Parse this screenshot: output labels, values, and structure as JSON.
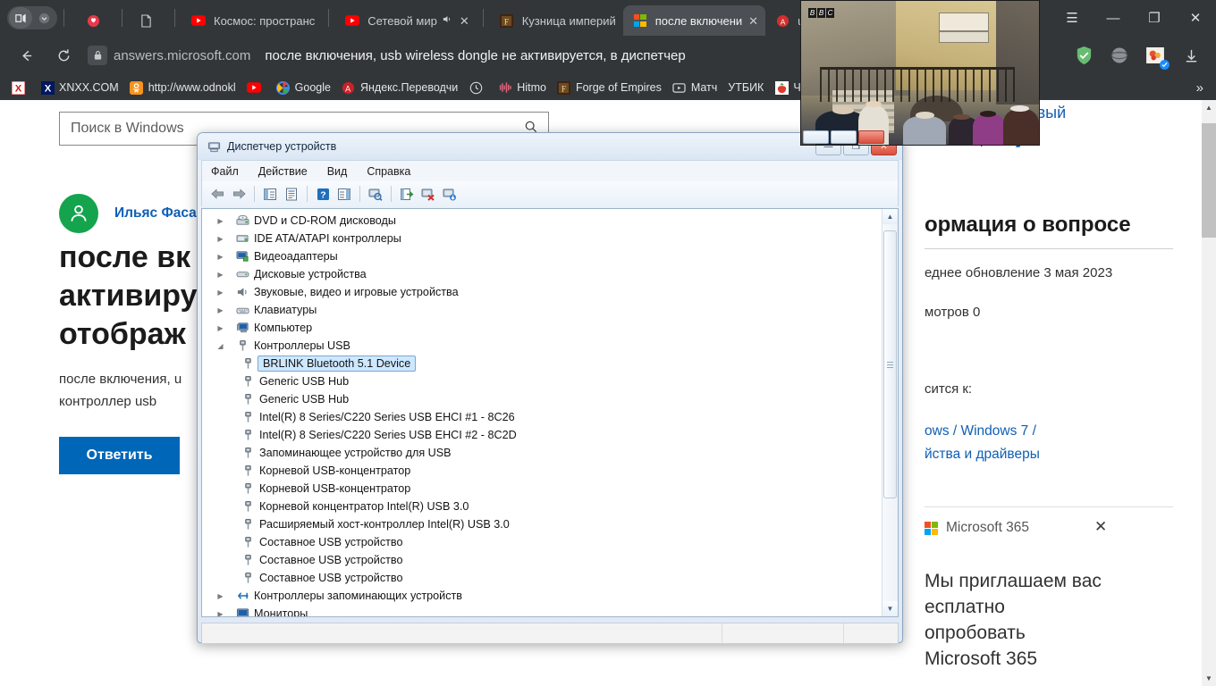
{
  "browser": {
    "tab_search_icon": "tab-list-icon",
    "tab_search_chevron": "chevron-down-icon",
    "tabs": [
      {
        "icon": "opera-heart-icon",
        "title": "",
        "has_close": false,
        "active": false
      },
      {
        "icon": "page-icon",
        "title": "",
        "has_close": false,
        "active": false
      },
      {
        "icon": "youtube-icon",
        "title": "Космос: пространс",
        "has_close": false,
        "active": false
      },
      {
        "icon": "youtube-icon",
        "title": "Сетевой мир",
        "has_close": true,
        "muted": true,
        "active": false
      },
      {
        "icon": "forge-icon",
        "title": "Кузница империй",
        "has_close": false,
        "active": false
      },
      {
        "icon": "microsoft-icon",
        "title": "после включени",
        "has_close": true,
        "active": true
      },
      {
        "icon": "avito-icon",
        "title": "us",
        "has_close": false,
        "active": false
      }
    ],
    "window_controls": {
      "menu": "☰",
      "minimize": "—",
      "maximize": "❐",
      "close": "✕"
    },
    "toolbar": {
      "back_icon": "arrow-left-icon",
      "reload_icon": "reload-icon",
      "lock_icon": "lock-icon",
      "url_host": "answers.microsoft.com",
      "url_title": "после включения, usb wireless dongle не активируется, в диспетчер",
      "extensions": [
        "adguard-shield-icon",
        "opera-vpn-icon",
        "flower-extension-icon"
      ],
      "download_icon": "download-icon"
    },
    "bookmarks": [
      {
        "icon": "x-red-icon",
        "label": ""
      },
      {
        "icon": "xnxx-icon",
        "label": "XNXX.COM"
      },
      {
        "icon": "odnoklassniki-icon",
        "label": "http://www.odnokl"
      },
      {
        "icon": "youtube-icon",
        "label": ""
      },
      {
        "icon": "google-icon",
        "label": "Google"
      },
      {
        "icon": "yandex-translate-icon",
        "label": "Яндекс.Переводчи"
      },
      {
        "icon": "clock-icon",
        "label": ""
      },
      {
        "icon": "hitmo-icon",
        "label": "Hitmo"
      },
      {
        "icon": "forge-icon",
        "label": "Forge of Empires"
      },
      {
        "icon": "match-tv-icon",
        "label": "Матч"
      },
      {
        "icon": "futbik-icon",
        "label": "УТБИК"
      },
      {
        "icon": "strawberry-icon",
        "label": "Чудо"
      },
      {
        "icon": "devil-icon",
        "label": ""
      }
    ],
    "bookmarks_overflow": "»"
  },
  "page": {
    "search_placeholder": "Поиск в Windows",
    "search_icon": "search-icon",
    "author": "Ильяс Фасах",
    "avatar_icon": "user-avatar-icon",
    "question_title_lines": [
      "после вк",
      "активиру",
      "отображ"
    ],
    "question_body_lines": [
      "после включения, u",
      "контроллер usb"
    ],
    "answer_button": "Ответить",
    "right": {
      "ask_link_line1": "дайте новый",
      "ask_link_line2": "прос",
      "ask_chevron": "❯",
      "info_heading": "ормация о вопросе",
      "last_updated": "еднее обновление 3 мая 2023",
      "views": "мотров 0",
      "applies_to": "сится к:",
      "links_line1": "ows / Windows 7 /",
      "links_line2": "йства и драйверы",
      "promo_brand": "Microsoft 365",
      "promo_close": "✕",
      "promo_lines": [
        "Мы приглашаем вас",
        "есплатно",
        "опробовать",
        "Microsoft 365"
      ]
    },
    "scrollbar": {
      "up": "▲",
      "down": "▼"
    }
  },
  "device_manager": {
    "title": "Диспетчер устройств",
    "title_icon": "device-manager-icon",
    "window_buttons": {
      "minimize": "—",
      "maximize": "❐",
      "close": "✕"
    },
    "menus": [
      "Файл",
      "Действие",
      "Вид",
      "Справка"
    ],
    "toolbar_icons": [
      "back-arrow-icon",
      "forward-arrow-icon",
      "sep",
      "show-hidden-icon",
      "properties-icon",
      "sep",
      "help-icon",
      "view-devices-icon",
      "sep",
      "scan-hardware-icon",
      "sep",
      "update-driver-icon",
      "uninstall-device-icon",
      "enable-device-icon"
    ],
    "tree": [
      {
        "label": "DVD и CD-ROM дисководы",
        "icon": "dvd-drive-icon",
        "level": 0,
        "expander": "▶",
        "selected": false
      },
      {
        "label": "IDE ATA/ATAPI контроллеры",
        "icon": "ide-controller-icon",
        "level": 0,
        "expander": "▶",
        "selected": false
      },
      {
        "label": "Видеоадаптеры",
        "icon": "display-adapter-icon",
        "level": 0,
        "expander": "▶",
        "selected": false
      },
      {
        "label": "Дисковые устройства",
        "icon": "disk-drive-icon",
        "level": 0,
        "expander": "▶",
        "selected": false
      },
      {
        "label": "Звуковые, видео и игровые устройства",
        "icon": "sound-device-icon",
        "level": 0,
        "expander": "▶",
        "selected": false
      },
      {
        "label": "Клавиатуры",
        "icon": "keyboard-icon",
        "level": 0,
        "expander": "▶",
        "selected": false
      },
      {
        "label": "Компьютер",
        "icon": "computer-icon",
        "level": 0,
        "expander": "▶",
        "selected": false
      },
      {
        "label": "Контроллеры USB",
        "icon": "usb-icon",
        "level": 0,
        "expander": "◢",
        "selected": false
      },
      {
        "label": "BRLINK Bluetooth 5.1 Device",
        "icon": "usb-icon",
        "level": 1,
        "expander": "",
        "selected": true
      },
      {
        "label": "Generic USB Hub",
        "icon": "usb-icon",
        "level": 1,
        "expander": "",
        "selected": false
      },
      {
        "label": "Generic USB Hub",
        "icon": "usb-icon",
        "level": 1,
        "expander": "",
        "selected": false
      },
      {
        "label": "Intel(R) 8 Series/C220 Series USB EHCI #1 - 8C26",
        "icon": "usb-icon",
        "level": 1,
        "expander": "",
        "selected": false
      },
      {
        "label": "Intel(R) 8 Series/C220 Series USB EHCI #2 - 8C2D",
        "icon": "usb-icon",
        "level": 1,
        "expander": "",
        "selected": false
      },
      {
        "label": "Запоминающее устройство для USB",
        "icon": "usb-icon",
        "level": 1,
        "expander": "",
        "selected": false
      },
      {
        "label": "Корневой USB-концентратор",
        "icon": "usb-icon",
        "level": 1,
        "expander": "",
        "selected": false
      },
      {
        "label": "Корневой USB-концентратор",
        "icon": "usb-icon",
        "level": 1,
        "expander": "",
        "selected": false
      },
      {
        "label": "Корневой концентратор Intel(R) USB 3.0",
        "icon": "usb-icon",
        "level": 1,
        "expander": "",
        "selected": false
      },
      {
        "label": "Расширяемый хост-контроллер Intel(R) USB 3.0",
        "icon": "usb-icon",
        "level": 1,
        "expander": "",
        "selected": false
      },
      {
        "label": "Составное USB устройство",
        "icon": "usb-icon",
        "level": 1,
        "expander": "",
        "selected": false
      },
      {
        "label": "Составное USB устройство",
        "icon": "usb-icon",
        "level": 1,
        "expander": "",
        "selected": false
      },
      {
        "label": "Составное USB устройство",
        "icon": "usb-icon",
        "level": 1,
        "expander": "",
        "selected": false
      },
      {
        "label": "Контроллеры запоминающих устройств",
        "icon": "storage-controller-icon",
        "level": 0,
        "expander": "▶",
        "selected": false
      },
      {
        "label": "Мониторы",
        "icon": "monitor-icon",
        "level": 0,
        "expander": "▶",
        "selected": false
      }
    ],
    "scrollbar": {
      "up": "▲",
      "down": "▼"
    }
  },
  "video_overlay": {
    "network_badge": "BBC",
    "scene_description": "Venice canal bridge with pedestrians",
    "window_buttons": {
      "minimize": "—",
      "maximize": "❐",
      "close": "✕"
    }
  },
  "colors": {
    "browser_chrome": "#323639",
    "accent_blue": "#0067b8",
    "link_blue": "#0f5fb5",
    "selection_blue": "#cde8ff",
    "avatar_green": "#14a44d"
  }
}
